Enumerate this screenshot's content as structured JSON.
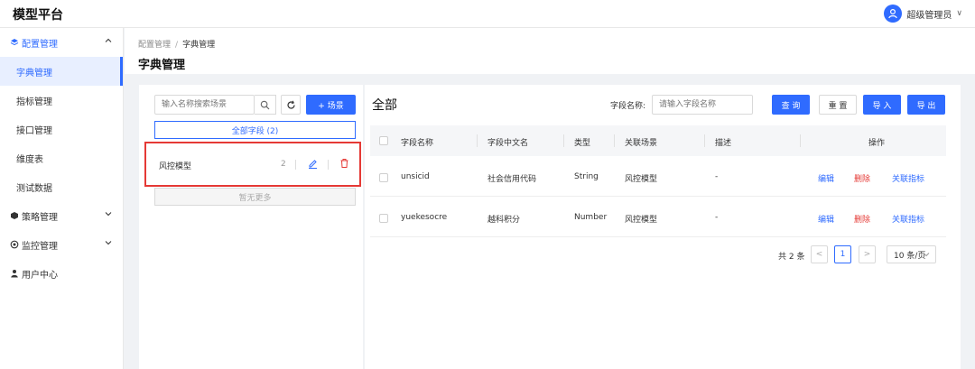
{
  "app": {
    "title": "模型平台"
  },
  "user": {
    "name": "超级管理员"
  },
  "sidebar": {
    "groups": [
      {
        "label": "配置管理",
        "icon": "layers-icon",
        "expanded": true,
        "items": [
          "字典管理",
          "指标管理",
          "接口管理",
          "维度表",
          "测试数据"
        ]
      },
      {
        "label": "策略管理",
        "icon": "cube-icon",
        "expanded": false
      },
      {
        "label": "监控管理",
        "icon": "monitor-icon",
        "expanded": false
      },
      {
        "label": "用户中心",
        "icon": "user-icon"
      }
    ],
    "active_item": "字典管理"
  },
  "breadcrumb": {
    "parent": "配置管理",
    "sep": "/",
    "current": "字典管理"
  },
  "page_title": "字典管理",
  "scene_panel": {
    "search_placeholder": "输入名称搜索场景",
    "add_label": "+ 场景",
    "all_fields_label": "全部字段 (2)",
    "items": [
      {
        "name": "风控模型",
        "count": "2"
      }
    ],
    "no_more_label": "暂无更多"
  },
  "main": {
    "title": "全部",
    "filter": {
      "label": "字段名称:",
      "placeholder": "请输入字段名称"
    },
    "buttons": {
      "query": "查 询",
      "reset": "重 置",
      "import": "导 入",
      "export": "导 出"
    },
    "table": {
      "columns": [
        "字段名称",
        "字段中文名",
        "类型",
        "关联场景",
        "描述",
        "操作"
      ],
      "rows": [
        {
          "name": "unsicid",
          "cn_name": "社会信用代码",
          "type": "String",
          "scene": "风控模型",
          "desc": "-"
        },
        {
          "name": "yuekesocre",
          "cn_name": "越科积分",
          "type": "Number",
          "scene": "风控模型",
          "desc": "-"
        }
      ],
      "actions": {
        "edit": "编辑",
        "delete": "删除",
        "link": "关联指标"
      }
    },
    "pagination": {
      "total": "共 2 条",
      "prev": "<",
      "current": "1",
      "next": ">",
      "page_size": "10 条/页"
    }
  },
  "colors": {
    "primary": "#2f6bff",
    "danger": "#e53935",
    "highlight_border": "#e53935"
  }
}
